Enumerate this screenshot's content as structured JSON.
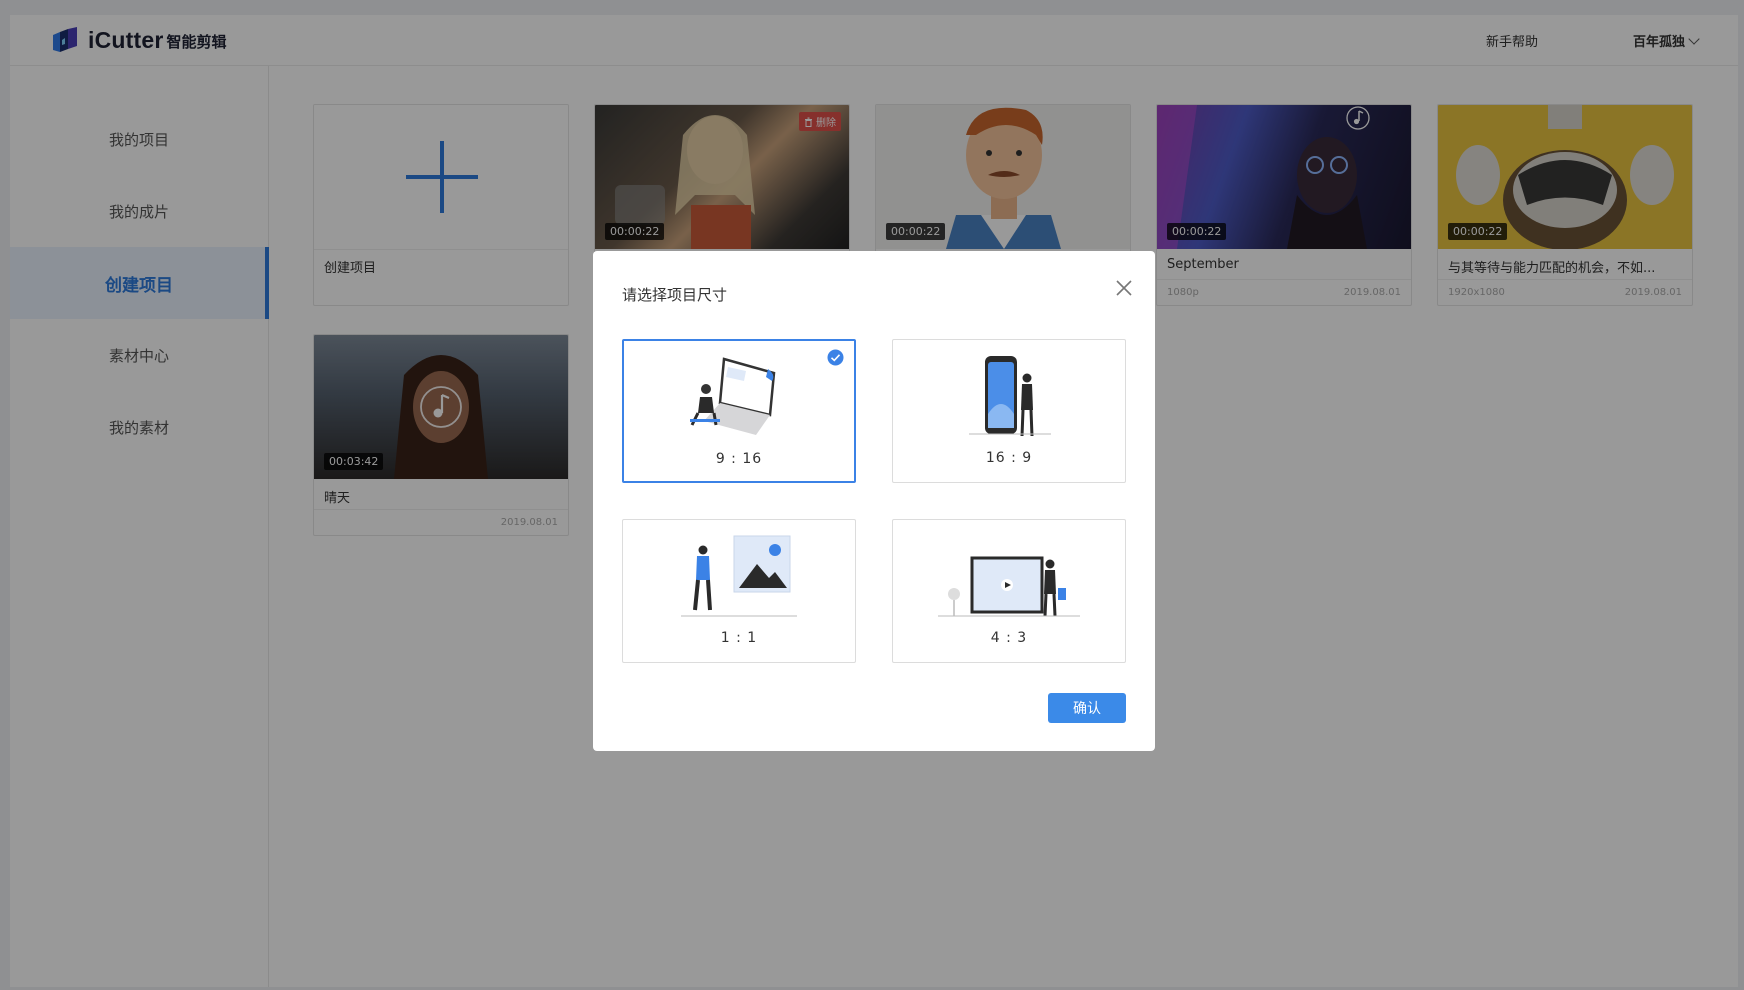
{
  "header": {
    "logo_text": "iCutter",
    "logo_subtitle": "智能剪辑",
    "help_link": "新手帮助",
    "user_name": "百年孤独"
  },
  "sidebar": {
    "items": [
      {
        "label": "我的项目"
      },
      {
        "label": "我的成片"
      },
      {
        "label": "创建项目",
        "active": true
      },
      {
        "label": "素材中心"
      },
      {
        "label": "我的素材"
      }
    ]
  },
  "projects": {
    "create_label": "创建项目",
    "delete_label": "删除",
    "cards": [
      {
        "duration": "00:00:22",
        "title": "",
        "resolution": "",
        "date": ""
      },
      {
        "duration": "00:00:22",
        "title": "",
        "resolution": "",
        "date": ""
      },
      {
        "duration": "00:00:22",
        "title": "September",
        "resolution": "1080p",
        "date": "2019.08.01"
      },
      {
        "duration": "00:00:22",
        "title": "与其等待与能力匹配的机会，不如...",
        "resolution": "1920x1080",
        "date": "2019.08.01"
      },
      {
        "duration": "00:03:42",
        "title": "晴天",
        "resolution": "",
        "date": "2019.08.01"
      }
    ]
  },
  "modal": {
    "title": "请选择项目尺寸",
    "options": [
      {
        "label": "9 : 16",
        "selected": true
      },
      {
        "label": "16 : 9",
        "selected": false
      },
      {
        "label": "1 : 1",
        "selected": false
      },
      {
        "label": "4 : 3",
        "selected": false
      }
    ],
    "confirm_label": "确认"
  },
  "colors": {
    "accent": "#3b82e6",
    "overlay": "rgba(0,0,0,0.4)",
    "delete_badge": "#e0504a"
  },
  "icons": [
    "logo-icon",
    "plus-icon",
    "trash-icon",
    "music-note-icon",
    "close-icon",
    "check-circle-icon",
    "chevron-down-icon"
  ]
}
